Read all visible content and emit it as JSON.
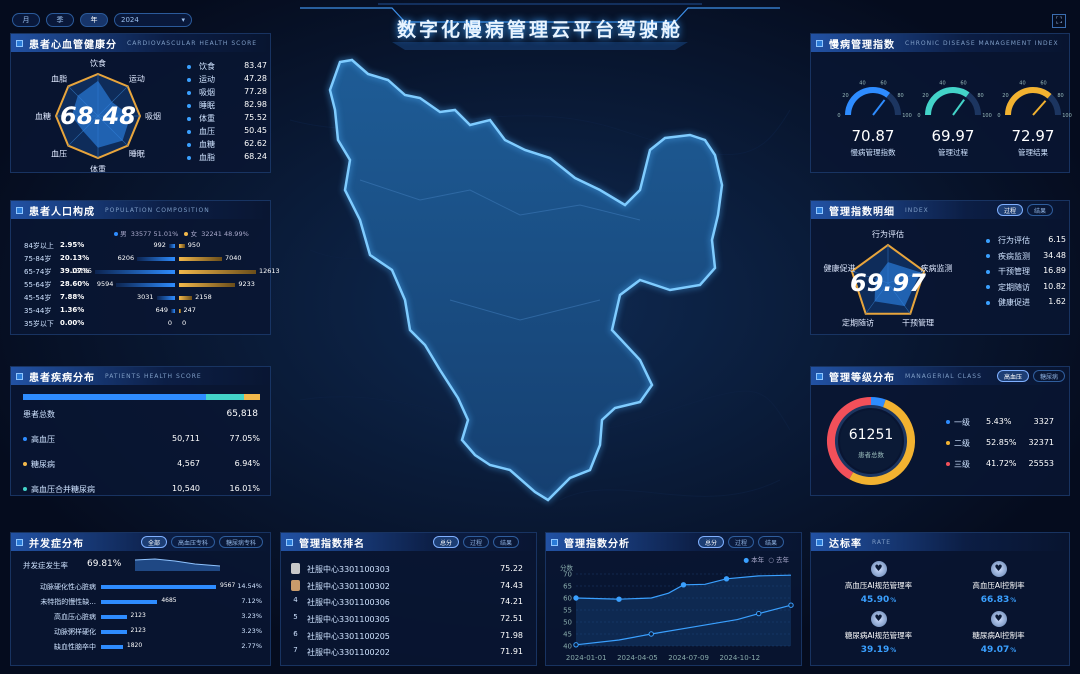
{
  "header": {
    "title": "数字化慢病管理云平台驾驶舱",
    "period_tabs": [
      "月",
      "季",
      "年"
    ],
    "active_period": "年",
    "year": "2024"
  },
  "cardio": {
    "title": "患者心血管健康分",
    "en": "CARDIOVASCULAR HEALTH SCORE",
    "score": "68.48",
    "radar_labels": [
      "饮食",
      "运动",
      "吸烟",
      "睡眠",
      "体重",
      "血压",
      "血糖",
      "血脂"
    ],
    "items": [
      {
        "label": "饮食",
        "value": "83.47"
      },
      {
        "label": "运动",
        "value": "47.28"
      },
      {
        "label": "吸烟",
        "value": "77.28"
      },
      {
        "label": "睡眠",
        "value": "82.98"
      },
      {
        "label": "体重",
        "value": "75.52"
      },
      {
        "label": "血压",
        "value": "50.45"
      },
      {
        "label": "血糖",
        "value": "62.62"
      },
      {
        "label": "血脂",
        "value": "68.24"
      }
    ]
  },
  "population": {
    "title": "患者人口构成",
    "en": "POPULATION COMPOSITION",
    "legend": {
      "male_label": "男",
      "male_count": "33577",
      "male_pct": "51.01%",
      "female_label": "女",
      "female_count": "32241",
      "female_pct": "48.99%"
    },
    "rows": [
      {
        "age": "84岁以上",
        "pct": "2.95%",
        "male": 992,
        "female": 950
      },
      {
        "age": "75-84岁",
        "pct": "20.13%",
        "male": 6206,
        "female": 7040
      },
      {
        "age": "65-74岁",
        "pct": "39.07%",
        "male": 13105,
        "female": 12613
      },
      {
        "age": "55-64岁",
        "pct": "28.60%",
        "male": 9594,
        "female": 9233
      },
      {
        "age": "45-54岁",
        "pct": "7.88%",
        "male": 3031,
        "female": 2158
      },
      {
        "age": "35-44岁",
        "pct": "1.36%",
        "male": 649,
        "female": 247
      },
      {
        "age": "35岁以下",
        "pct": "0.00%",
        "male": 0,
        "female": 0
      }
    ]
  },
  "disease": {
    "title": "患者疾病分布",
    "en": "PATIENTS HEALTH SCORE",
    "total_label": "患者总数",
    "total": "65,818",
    "bar_fractions": [
      0.7705,
      0.1601,
      0.0694
    ],
    "items": [
      {
        "label": "高血压",
        "count": "50,711",
        "pct": "77.05%",
        "color": "#2e8cff"
      },
      {
        "label": "糖尿病",
        "count": "4,567",
        "pct": "6.94%",
        "color": "#f2b84b"
      },
      {
        "label": "高血压合并糖尿病",
        "count": "10,540",
        "pct": "16.01%",
        "color": "#43d3c8"
      }
    ]
  },
  "complication": {
    "title": "并发症分布",
    "tabs": [
      "全部",
      "高血压专科",
      "糖尿病专科"
    ],
    "rate_label": "并发症发生率",
    "rate": "69.81%",
    "items": [
      {
        "label": "动脉硬化性心脏病",
        "count": 9567,
        "pct": "14.54%"
      },
      {
        "label": "未特指的慢性缺...",
        "count": 4685,
        "pct": "7.12%"
      },
      {
        "label": "高血压心脏病",
        "count": 2123,
        "pct": "3.23%"
      },
      {
        "label": "动脉粥样硬化",
        "count": 2123,
        "pct": "3.23%"
      },
      {
        "label": "缺血性脑卒中",
        "count": 1820,
        "pct": "2.77%"
      }
    ]
  },
  "ranking": {
    "title": "管理指数排名",
    "tabs": [
      "总分",
      "过程",
      "结果"
    ],
    "items": [
      {
        "rank": "1",
        "name": "社服中心3301100303",
        "score": "75.22"
      },
      {
        "rank": "2",
        "name": "社服中心3301100302",
        "score": "74.43"
      },
      {
        "rank": "4",
        "name": "社服中心3301100306",
        "score": "74.21"
      },
      {
        "rank": "5",
        "name": "社服中心3301100305",
        "score": "72.51"
      },
      {
        "rank": "6",
        "name": "社服中心3301100205",
        "score": "71.98"
      },
      {
        "rank": "7",
        "name": "社服中心3301100202",
        "score": "71.91"
      }
    ]
  },
  "analysis": {
    "title": "管理指数分析",
    "tabs": [
      "总分",
      "过程",
      "结果"
    ],
    "legend_this": "本年",
    "legend_last": "去年",
    "y_label": "分数"
  },
  "chart_data": {
    "type": "line",
    "x": [
      "2024-01-01",
      "2024-04-05",
      "2024-07-09",
      "2024-10-12"
    ],
    "y_ticks": [
      40,
      45,
      50,
      55,
      60,
      65,
      70
    ],
    "ylim": [
      40,
      70
    ],
    "series": [
      {
        "name": "本年",
        "points": [
          [
            0,
            60
          ],
          [
            0.17,
            59.6
          ],
          [
            0.2,
            59.5
          ],
          [
            0.35,
            60
          ],
          [
            0.43,
            62
          ],
          [
            0.5,
            65.5
          ],
          [
            0.6,
            65.7
          ],
          [
            0.7,
            68
          ],
          [
            0.85,
            69.2
          ],
          [
            1,
            69.5
          ]
        ]
      },
      {
        "name": "去年",
        "points": [
          [
            0,
            40.5
          ],
          [
            0.2,
            42.5
          ],
          [
            0.35,
            45
          ],
          [
            0.55,
            48
          ],
          [
            0.75,
            51
          ],
          [
            0.85,
            53.5
          ],
          [
            1,
            57
          ]
        ]
      }
    ]
  },
  "chronic": {
    "title": "慢病管理指数",
    "en": "CHRONIC DISEASE MANAGEMENT INDEX",
    "gauges": [
      {
        "value": "70.87",
        "label": "慢病管理指数",
        "color": "#2e8cff",
        "fraction": 0.7087
      },
      {
        "value": "69.97",
        "label": "管理过程",
        "color": "#43d3c8",
        "fraction": 0.6997
      },
      {
        "value": "72.97",
        "label": "管理结果",
        "color": "#f2b230",
        "fraction": 0.7297
      }
    ],
    "ticks": [
      "0",
      "20",
      "40",
      "60",
      "80",
      "100"
    ]
  },
  "detail": {
    "title": "管理指数明细",
    "en": "INDEX",
    "tabs": [
      "过程",
      "结果"
    ],
    "score": "69.97",
    "radar_labels": [
      "行为评估",
      "疾病监测",
      "干预管理",
      "定期随访",
      "健康促进"
    ],
    "items": [
      {
        "label": "行为评估",
        "value": "6.15"
      },
      {
        "label": "疾病监测",
        "value": "34.48"
      },
      {
        "label": "干预管理",
        "value": "16.89"
      },
      {
        "label": "定期随访",
        "value": "10.82"
      },
      {
        "label": "健康促进",
        "value": "1.62"
      }
    ]
  },
  "level": {
    "title": "管理等级分布",
    "en": "MANAGERIAL CLASS",
    "tabs": [
      "高血压",
      "糖尿病"
    ],
    "total": "61251",
    "total_label": "患者总数",
    "items": [
      {
        "label": "一级",
        "pct": "5.43%",
        "count": "3327",
        "color": "#2e8cff",
        "fraction": 0.0543
      },
      {
        "label": "二级",
        "pct": "52.85%",
        "count": "32371",
        "color": "#f2b230",
        "fraction": 0.5285
      },
      {
        "label": "三级",
        "pct": "41.72%",
        "count": "25553",
        "color": "#f2505a",
        "fraction": 0.4172
      }
    ]
  },
  "rate": {
    "title": "达标率",
    "en": "RATE",
    "items": [
      {
        "label": "高血压AI规范管理率",
        "value": "45.90",
        "unit": "%"
      },
      {
        "label": "高血压AI控制率",
        "value": "66.83",
        "unit": "%"
      },
      {
        "label": "糖尿病AI规范管理率",
        "value": "39.19",
        "unit": "%"
      },
      {
        "label": "糖尿病AI控制率",
        "value": "49.07",
        "unit": "%"
      }
    ]
  }
}
